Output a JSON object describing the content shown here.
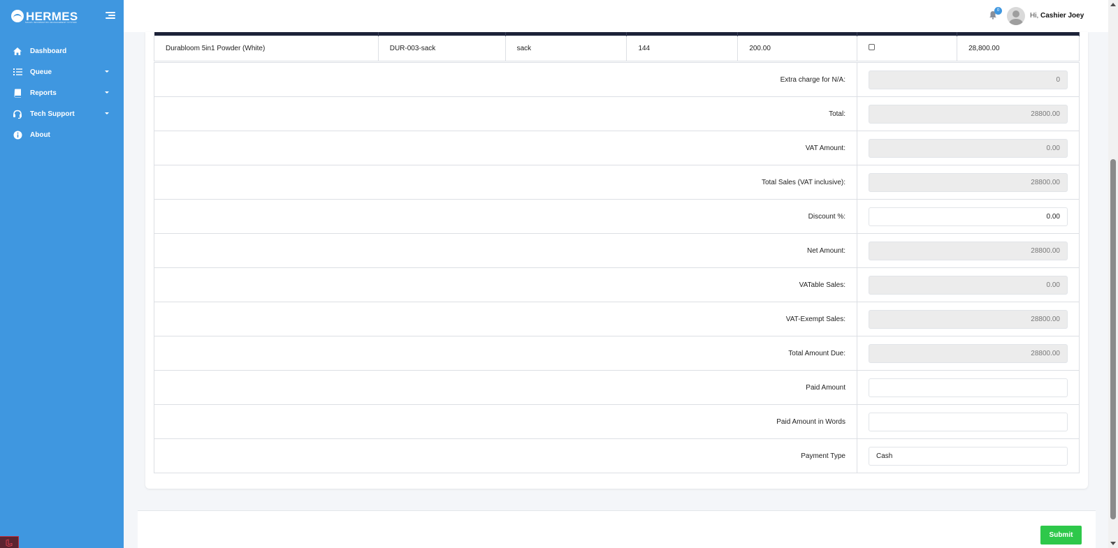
{
  "brand": {
    "name": "HERMES",
    "subtitle": "SALES INFORMATION MANAGEMENT SYSTEM"
  },
  "sidebar": {
    "items": [
      {
        "label": "Dashboard",
        "icon": "home-icon",
        "has_submenu": false
      },
      {
        "label": "Queue",
        "icon": "list-icon",
        "has_submenu": true
      },
      {
        "label": "Reports",
        "icon": "book-icon",
        "has_submenu": true
      },
      {
        "label": "Tech Support",
        "icon": "headset-icon",
        "has_submenu": true
      },
      {
        "label": "About",
        "icon": "info-icon",
        "has_submenu": false
      }
    ]
  },
  "topbar": {
    "notification_count": "0",
    "greeting_prefix": "Hi,",
    "user_name": "Cashier Joey"
  },
  "item_row": {
    "product": "Durabloom 5in1 Powder (White)",
    "code": "DUR-003-sack",
    "unit": "sack",
    "quantity": "144",
    "price": "200.00",
    "amount": "28,800.00"
  },
  "summary": {
    "extra_charge": {
      "label": "Extra charge for N/A:",
      "value": "0"
    },
    "total": {
      "label": "Total:",
      "value": "28800.00"
    },
    "vat_amount": {
      "label": "VAT Amount:",
      "value": "0.00"
    },
    "total_sales": {
      "label": "Total Sales (VAT inclusive):",
      "value": "28800.00"
    },
    "discount": {
      "label": "Discount %:",
      "value": "0.00"
    },
    "net_amount": {
      "label": "Net Amount:",
      "value": "28800.00"
    },
    "vatable_sales": {
      "label": "VATable Sales:",
      "value": "0.00"
    },
    "vat_exempt_sales": {
      "label": "VAT-Exempt Sales:",
      "value": "28800.00"
    },
    "total_amount_due": {
      "label": "Total Amount Due:",
      "value": "28800.00"
    },
    "paid_amount": {
      "label": "Paid Amount",
      "value": ""
    },
    "paid_amount_words": {
      "label": "Paid Amount in Words",
      "value": ""
    },
    "payment_type": {
      "label": "Payment Type",
      "value": "Cash"
    }
  },
  "footer": {
    "submit_label": "Submit"
  },
  "colors": {
    "sidebar": "#3f97e0",
    "header_dark": "#1c2238",
    "submit": "#2ec84a"
  }
}
